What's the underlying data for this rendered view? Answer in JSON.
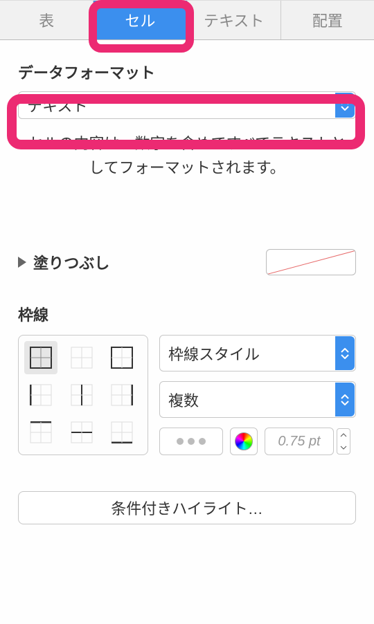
{
  "tabs": {
    "items": [
      "表",
      "セル",
      "テキスト",
      "配置"
    ],
    "active_index": 1
  },
  "data_format": {
    "label": "データフォーマット",
    "value": "テキスト",
    "help": "セルの内容は、数字を含めてすべてテキストとしてフォーマットされます。"
  },
  "fill": {
    "label": "塗りつぶし"
  },
  "border": {
    "label": "枠線",
    "style_select": "枠線スタイル",
    "count_select": "複数",
    "width_value": "0.75 pt"
  },
  "action": {
    "conditional_highlight": "条件付きハイライト…"
  }
}
